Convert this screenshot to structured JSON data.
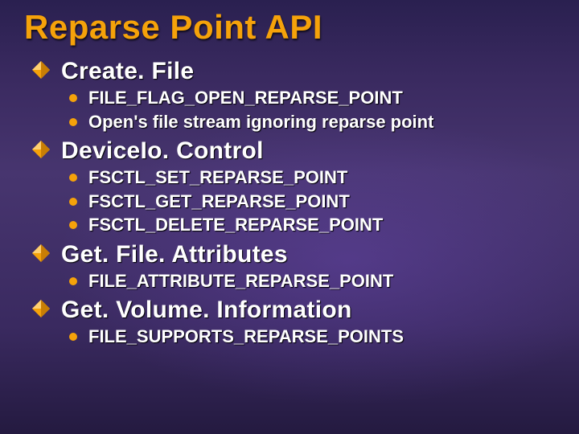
{
  "title": "Reparse Point API",
  "sections": [
    {
      "heading": "Create. File",
      "items": [
        "FILE_FLAG_OPEN_REPARSE_POINT",
        "Open's file stream ignoring reparse point"
      ]
    },
    {
      "heading": "DeviceIo. Control",
      "items": [
        "FSCTL_SET_REPARSE_POINT",
        "FSCTL_GET_REPARSE_POINT",
        "FSCTL_DELETE_REPARSE_POINT"
      ]
    },
    {
      "heading": "Get. File. Attributes",
      "items": [
        "FILE_ATTRIBUTE_REPARSE_POINT"
      ]
    },
    {
      "heading": "Get. Volume. Information",
      "items": [
        "FILE_SUPPORTS_REPARSE_POINTS"
      ]
    }
  ]
}
